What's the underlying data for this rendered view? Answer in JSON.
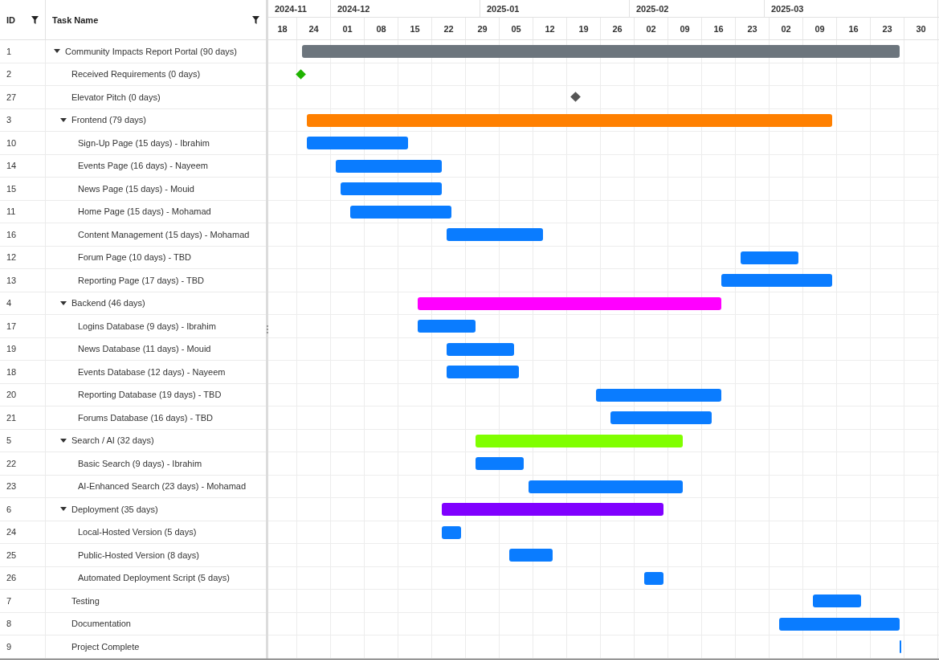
{
  "grid": {
    "columns": [
      {
        "label": "ID",
        "filter": true
      },
      {
        "label": "Task Name",
        "filter": true
      }
    ]
  },
  "timeline": {
    "months": [
      "2024-11",
      "2024-12",
      "2025-01",
      "2025-02",
      "2025-03"
    ],
    "weeks": [
      "18",
      "24",
      "01",
      "08",
      "15",
      "22",
      "29",
      "05",
      "12",
      "19",
      "26",
      "02",
      "09",
      "16",
      "23",
      "02",
      "09",
      "16",
      "23",
      "30"
    ]
  },
  "tasks": [
    {
      "id": "1",
      "name": "Community Impacts Report Portal (90 days)",
      "kind": "bar",
      "color": "#6c757d",
      "expanded": true,
      "children": [
        {
          "id": "2",
          "name": "Received Requirements (0 days)",
          "kind": "milestone",
          "color": "#1fb300"
        },
        {
          "id": "27",
          "name": "Elevator Pitch (0 days)",
          "kind": "milestone",
          "color": "#555555"
        },
        {
          "id": "3",
          "name": "Frontend (79 days)",
          "kind": "bar",
          "color": "#ff8000",
          "expanded": true,
          "children": [
            {
              "id": "10",
              "name": "Sign-Up Page (15 days) - Ibrahim",
              "kind": "bar",
              "color": "#0a7cff"
            },
            {
              "id": "14",
              "name": "Events Page (16 days) - Nayeem",
              "kind": "bar",
              "color": "#0a7cff"
            },
            {
              "id": "15",
              "name": "News Page (15 days) - Mouid",
              "kind": "bar",
              "color": "#0a7cff"
            },
            {
              "id": "11",
              "name": "Home Page (15 days) - Mohamad",
              "kind": "bar",
              "color": "#0a7cff"
            },
            {
              "id": "16",
              "name": "Content Management (15 days) - Mohamad",
              "kind": "bar",
              "color": "#0a7cff"
            },
            {
              "id": "12",
              "name": "Forum Page (10 days) - TBD",
              "kind": "bar",
              "color": "#0a7cff"
            },
            {
              "id": "13",
              "name": "Reporting Page (17 days) - TBD",
              "kind": "bar",
              "color": "#0a7cff"
            }
          ]
        },
        {
          "id": "4",
          "name": "Backend (46 days)",
          "kind": "bar",
          "color": "#ff00ff",
          "expanded": true,
          "children": [
            {
              "id": "17",
              "name": "Logins Database (9 days) - Ibrahim",
              "kind": "bar",
              "color": "#0a7cff"
            },
            {
              "id": "19",
              "name": "News Database (11 days) - Mouid",
              "kind": "bar",
              "color": "#0a7cff"
            },
            {
              "id": "18",
              "name": "Events Database (12 days) - Nayeem",
              "kind": "bar",
              "color": "#0a7cff"
            },
            {
              "id": "20",
              "name": "Reporting Database (19 days) - TBD",
              "kind": "bar",
              "color": "#0a7cff"
            },
            {
              "id": "21",
              "name": "Forums Database (16 days) - TBD",
              "kind": "bar",
              "color": "#0a7cff"
            }
          ]
        },
        {
          "id": "5",
          "name": "Search / AI (32 days)",
          "kind": "bar",
          "color": "#80ff00",
          "expanded": true,
          "children": [
            {
              "id": "22",
              "name": "Basic Search (9 days) - Ibrahim",
              "kind": "bar",
              "color": "#0a7cff"
            },
            {
              "id": "23",
              "name": "AI-Enhanced Search (23 days) - Mohamad",
              "kind": "bar",
              "color": "#0a7cff"
            }
          ]
        },
        {
          "id": "6",
          "name": "Deployment (35 days)",
          "kind": "bar",
          "color": "#8000ff",
          "expanded": true,
          "children": [
            {
              "id": "24",
              "name": "Local-Hosted Version (5 days)",
              "kind": "bar",
              "color": "#0a7cff"
            },
            {
              "id": "25",
              "name": "Public-Hosted Version (8 days)",
              "kind": "bar",
              "color": "#0a7cff"
            },
            {
              "id": "26",
              "name": "Automated Deployment Script (5 days)",
              "kind": "bar",
              "color": "#0a7cff"
            }
          ]
        },
        {
          "id": "7",
          "name": "Testing",
          "kind": "bar",
          "color": "#0a7cff"
        },
        {
          "id": "8",
          "name": "Documentation",
          "kind": "bar",
          "color": "#0a7cff"
        },
        {
          "id": "9",
          "name": "Project Complete",
          "kind": "bar",
          "color": "#0a7cff"
        }
      ]
    }
  ]
}
